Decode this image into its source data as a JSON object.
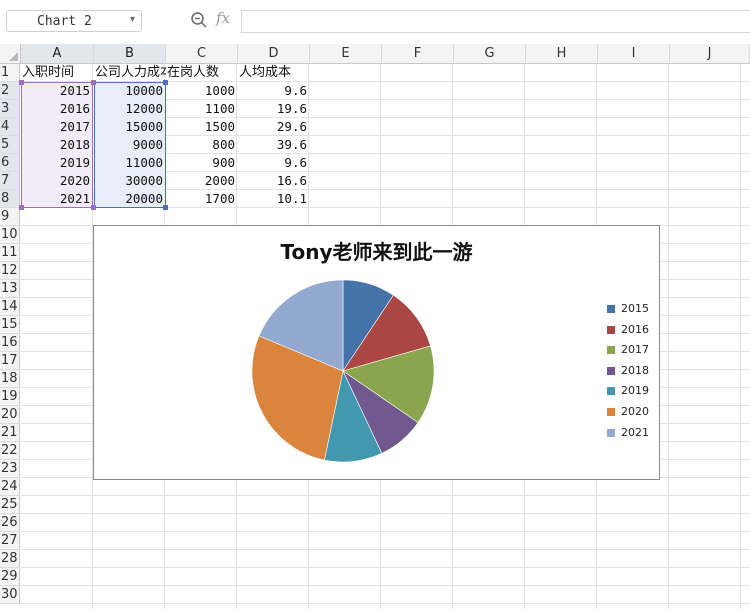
{
  "toolbar": {
    "name_box": "Chart 2",
    "fx_label": "fx",
    "formula_value": ""
  },
  "columns": [
    "A",
    "B",
    "C",
    "D",
    "E",
    "F",
    "G",
    "H",
    "I",
    "J"
  ],
  "rows": [
    "1",
    "2",
    "3",
    "4",
    "5",
    "6",
    "7",
    "8",
    "9",
    "10",
    "11",
    "12",
    "13",
    "14",
    "15",
    "16",
    "17",
    "18",
    "19",
    "20",
    "21",
    "22",
    "23",
    "24",
    "25",
    "26",
    "27",
    "28",
    "29",
    "30"
  ],
  "table": {
    "headers": [
      "入职时间",
      "公司人力成本",
      "在岗人数",
      "人均成本"
    ],
    "rows": [
      [
        "2015",
        "10000",
        "1000",
        "9.6"
      ],
      [
        "2016",
        "12000",
        "1100",
        "19.6"
      ],
      [
        "2017",
        "15000",
        "1500",
        "29.6"
      ],
      [
        "2018",
        "9000",
        "800",
        "39.6"
      ],
      [
        "2019",
        "11000",
        "900",
        "9.6"
      ],
      [
        "2020",
        "30000",
        "2000",
        "16.6"
      ],
      [
        "2021",
        "20000",
        "1700",
        "10.1"
      ]
    ]
  },
  "colors": {
    "series": [
      "#4573a7",
      "#aa4643",
      "#89a54e",
      "#71588f",
      "#4198af",
      "#db843d",
      "#93a9cf"
    ],
    "selection_a": "#9a6fbd",
    "selection_b": "#4b6fbf"
  },
  "chart_data": {
    "type": "pie",
    "title": "Tony老师来到此一游",
    "categories": [
      "2015",
      "2016",
      "2017",
      "2018",
      "2019",
      "2020",
      "2021"
    ],
    "values": [
      10000,
      12000,
      15000,
      9000,
      11000,
      30000,
      20000
    ],
    "legend_position": "right"
  }
}
